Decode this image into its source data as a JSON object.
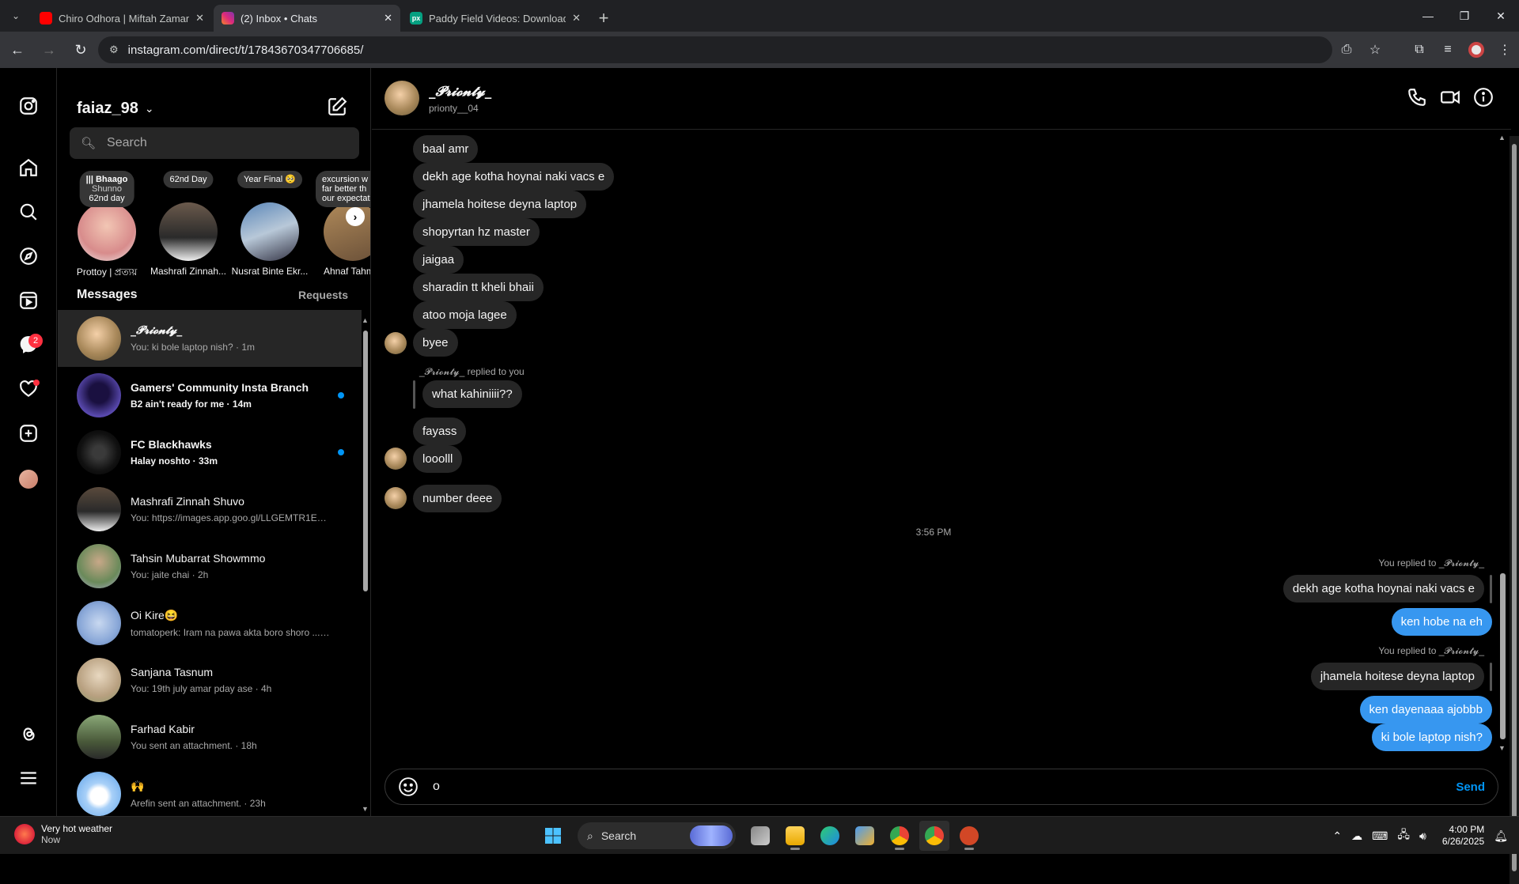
{
  "browser": {
    "tabs": [
      {
        "title": "Chiro Odhora | Miftah Zaman -",
        "favicon_color": "#ff0000",
        "active": false
      },
      {
        "title": "(2) Inbox • Chats",
        "favicon_color": "#e1306c",
        "active": true
      },
      {
        "title": "Paddy Field Videos: Download",
        "favicon_color": "#05a081",
        "favicon_text": "px",
        "active": false
      }
    ],
    "url": "instagram.com/direct/t/17843670347706685/"
  },
  "inbox": {
    "username": "faiaz_98",
    "search_placeholder": "Search",
    "notes": [
      {
        "text_lines": [
          "||| Bhaago",
          "Shunno",
          "62nd day"
        ],
        "name": "Prottoy | প্রত্যয়"
      },
      {
        "text_lines": [
          "62nd Day"
        ],
        "name": "Mashrafi Zinnah..."
      },
      {
        "text_lines": [
          "Year Final 🥺"
        ],
        "name": "Nusrat Binte Ekr..."
      },
      {
        "text_lines": [
          "excursion w",
          "far better th",
          "our expectat"
        ],
        "name": "Ahnaf Tahm"
      }
    ],
    "messages_label": "Messages",
    "requests_label": "Requests",
    "conversations": [
      {
        "name": "_𝓟𝓻𝓲𝓸𝓷𝓽𝔂_",
        "preview": "You: ki bole laptop nish? · 1m",
        "active": true,
        "unread": false
      },
      {
        "name": "Gamers' Community Insta Branch",
        "preview": "B2 ain't ready for me · 14m",
        "active": false,
        "unread": true
      },
      {
        "name": "FC Blackhawks",
        "preview": "Halay noshto · 33m",
        "active": false,
        "unread": true
      },
      {
        "name": "Mashrafi Zinnah Shuvo",
        "preview": "You: https://images.app.goo.gl/LLGEMTR1EE... · 2h",
        "active": false,
        "unread": false
      },
      {
        "name": "Tahsin Mubarrat Showmmo",
        "preview": "You: jaite chai · 2h",
        "active": false,
        "unread": false
      },
      {
        "name": "Oi Kire😆",
        "preview": "tomatoperk: Iram na pawa akta boro shoro ... · 3h",
        "active": false,
        "unread": false
      },
      {
        "name": "Sanjana Tasnum",
        "preview": "You: 19th july amar pday ase · 4h",
        "active": false,
        "unread": false
      },
      {
        "name": "Farhad Kabir",
        "preview": "You sent an attachment. · 18h",
        "active": false,
        "unread": false
      },
      {
        "name": "🙌",
        "preview": "Arefin sent an attachment. · 23h",
        "active": false,
        "unread": false
      }
    ]
  },
  "nav": {
    "notification_count": "2"
  },
  "chat": {
    "display_name": "_𝓟𝓻𝓲𝓸𝓷𝓽𝔂_",
    "username": "prionty__04",
    "messages": [
      {
        "text": "baal amr"
      },
      {
        "text": "dekh age kotha hoynai naki vacs e"
      },
      {
        "text": "jhamela hoitese deyna laptop"
      },
      {
        "text": "shopyrtan hz master"
      },
      {
        "text": "jaigaa"
      },
      {
        "text": "sharadin tt kheli bhaii"
      },
      {
        "text": "atoo moja lagee"
      },
      {
        "text": "byee"
      },
      {
        "text": "what kahiniiii??"
      },
      {
        "text": "fayass"
      },
      {
        "text": "looolll"
      },
      {
        "text": "number deee"
      },
      {
        "text": "dekh age kotha hoynai naki vacs e"
      },
      {
        "text": "ken hobe na eh"
      },
      {
        "text": "jhamela hoitese deyna laptop"
      },
      {
        "text": "ken dayenaaa ajobbb"
      },
      {
        "text": "ki bole laptop nish?"
      }
    ],
    "replied_to_you": "_𝓟𝓻𝓲𝓸𝓷𝓽𝔂_ replied to you",
    "you_replied_1": "You replied to _𝓟𝓻𝓲𝓸𝓷𝓽𝔂_",
    "you_replied_2": "You replied to _𝓟𝓻𝓲𝓸𝓷𝓽𝔂_",
    "timestamp": "3:56 PM",
    "composer_value": "o",
    "send_label": "Send"
  },
  "taskbar": {
    "weather_title": "Very hot weather",
    "weather_sub": "Now",
    "search_label": "Search",
    "time": "4:00 PM",
    "date": "6/26/2025"
  }
}
